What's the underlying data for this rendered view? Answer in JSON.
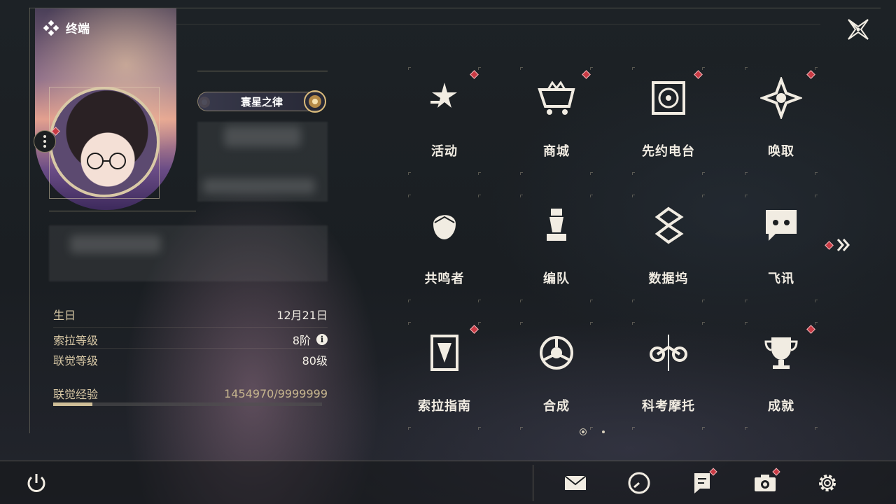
{
  "header": {
    "title": "终端"
  },
  "profile": {
    "title_badge": "寰星之律",
    "info": [
      {
        "label": "生日",
        "value": "12月21日"
      },
      {
        "label": "索拉等级",
        "value": "8阶"
      },
      {
        "label": "联觉等级",
        "value": "80级"
      },
      {
        "label": "联觉经验",
        "value": "1454970/9999999"
      }
    ],
    "exp_fraction": 0.145
  },
  "menu": {
    "items": [
      {
        "label": "活动",
        "icon": "activity-icon",
        "badge": true
      },
      {
        "label": "商城",
        "icon": "shop-cart-icon",
        "badge": true
      },
      {
        "label": "先约电台",
        "icon": "radio-turntable-icon",
        "badge": true
      },
      {
        "label": "唤取",
        "icon": "summon-compass-icon",
        "badge": true
      },
      {
        "label": "共鸣者",
        "icon": "resonator-profile-icon",
        "badge": false
      },
      {
        "label": "编队",
        "icon": "team-chess-icon",
        "badge": false
      },
      {
        "label": "数据坞",
        "icon": "data-dock-icon",
        "badge": false
      },
      {
        "label": "飞讯",
        "icon": "message-chat-icon",
        "badge": false
      },
      {
        "label": "索拉指南",
        "icon": "guide-book-icon",
        "badge": true
      },
      {
        "label": "合成",
        "icon": "synthesis-icon",
        "badge": false
      },
      {
        "label": "科考摩托",
        "icon": "motorbike-icon",
        "badge": false
      },
      {
        "label": "成就",
        "icon": "achievement-trophy-icon",
        "badge": true
      }
    ],
    "page_count": 2,
    "current_page": 1
  },
  "bottom_bar": {
    "buttons": [
      {
        "icon": "power-icon",
        "badge": false
      },
      {
        "icon": "mail-icon",
        "badge": false
      },
      {
        "icon": "clock-icon",
        "badge": false
      },
      {
        "icon": "notice-icon",
        "badge": true
      },
      {
        "icon": "camera-icon",
        "badge": true
      },
      {
        "icon": "settings-gear-icon",
        "badge": false
      }
    ]
  },
  "colors": {
    "accent_gold": "#d9c9a6",
    "badge_red": "#c93a44",
    "text": "#f1ece2"
  }
}
